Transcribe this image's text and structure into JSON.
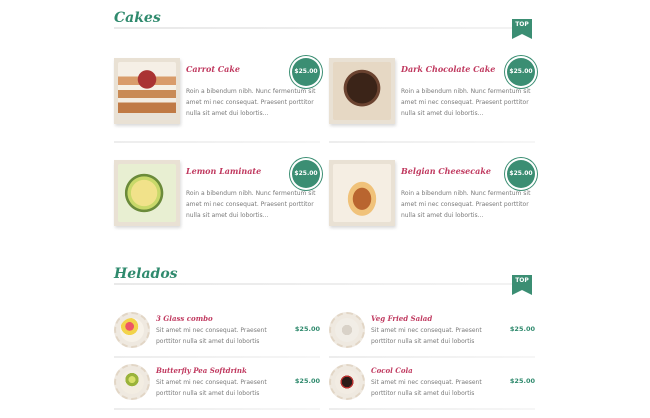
{
  "sections": [
    {
      "title": "Cakes",
      "top_label": "TOP"
    },
    {
      "title": "Helados",
      "top_label": "TOP"
    }
  ],
  "cakes": [
    {
      "title": "Carrot Cake",
      "price": "$25.00",
      "description": "Roin a bibendum nibh. Nunc fermentum sit amet mi nec consequat. Praesent porttitor nulla sit amet dui lobortis...",
      "image": "carrot-cake-photo"
    },
    {
      "title": "Dark Chocolate Cake",
      "price": "$25.00",
      "description": "Roin a bibendum nibh. Nunc fermentum sit amet mi nec consequat. Praesent porttitor nulla sit amet dui lobortis...",
      "image": "chocolate-cake-photo"
    },
    {
      "title": "Lemon Laminate",
      "price": "$25.00",
      "description": "Roin a bibendum nibh. Nunc fermentum sit amet mi nec consequat. Praesent porttitor nulla sit amet dui lobortis...",
      "image": "lemon-cake-photo"
    },
    {
      "title": "Belgian Cheesecake",
      "price": "$25.00",
      "description": "Roin a bibendum nibh. Nunc fermentum sit amet mi nec consequat. Praesent porttitor nulla sit amet dui lobortis...",
      "image": "cheesecake-photo"
    }
  ],
  "helados": [
    {
      "title": "3 Glass combo",
      "price": "$25.00",
      "description": "Sit amet mi nec consequat. Praesent porttitor nulla sit amet dui lobortis",
      "image": "glass-combo-photo"
    },
    {
      "title": "Veg Fried Salad",
      "price": "$25.00",
      "description": "Sit amet mi nec consequat. Praesent porttitor nulla sit amet dui lobortis",
      "image": "salad-photo"
    },
    {
      "title": "Butterfly Pea Softdrink",
      "price": "$25.00",
      "description": "Sit amet mi nec consequat. Praesent porttitor nulla sit amet dui lobortis",
      "image": "softdrink-photo"
    },
    {
      "title": "Cocol Cola",
      "price": "$25.00",
      "description": "Sit amet mi nec consequat. Praesent porttitor nulla sit amet dui lobortis",
      "image": "cola-photo"
    }
  ],
  "colors": {
    "accent_green": "#3b8e73",
    "title_pink": "#c0395f",
    "text_gray": "#7a7a7a"
  }
}
